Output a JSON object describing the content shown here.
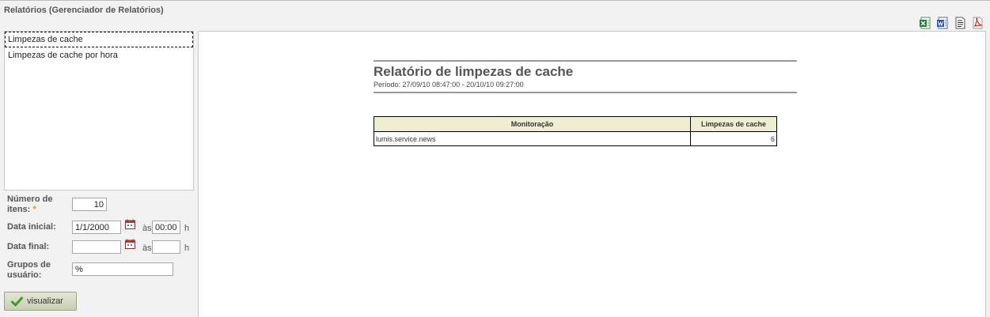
{
  "window": {
    "title": "Relatórios (Gerenciador de Relatórios)"
  },
  "toolbar": {
    "icons": [
      "excel-icon",
      "word-icon",
      "text-export-icon",
      "pdf-icon"
    ]
  },
  "report_list": {
    "items": [
      "Limpezas de cache",
      "Limpezas de cache por hora"
    ],
    "selected_index": 0
  },
  "form": {
    "num_items_label_1": "Número de",
    "num_items_label_2": "itens:",
    "required_marker": "*",
    "num_items_value": "10",
    "start_date_label": "Data inicial:",
    "start_date_value": "1/1/2000",
    "as_label": "às",
    "start_time_value": "00:00",
    "h_label": "h",
    "end_date_label": "Data final:",
    "end_date_value": "",
    "end_time_value": "",
    "groups_label_1": "Grupos de",
    "groups_label_2": "usuário:",
    "groups_value": "%",
    "submit_label": "visualizar"
  },
  "report": {
    "title": "Relatório de limpezas de cache",
    "period": "Período: 27/09/10 08:47:00 - 20/10/10 09:27:00",
    "table": {
      "headers": [
        "Monitoração",
        "Limpezas de cache"
      ],
      "rows": [
        [
          "lumis.service.news",
          "6"
        ]
      ]
    }
  },
  "colors": {
    "table_header_bg": "#efeed3",
    "button_bg": "#d4d9c2",
    "required_marker": "#e8931a"
  }
}
